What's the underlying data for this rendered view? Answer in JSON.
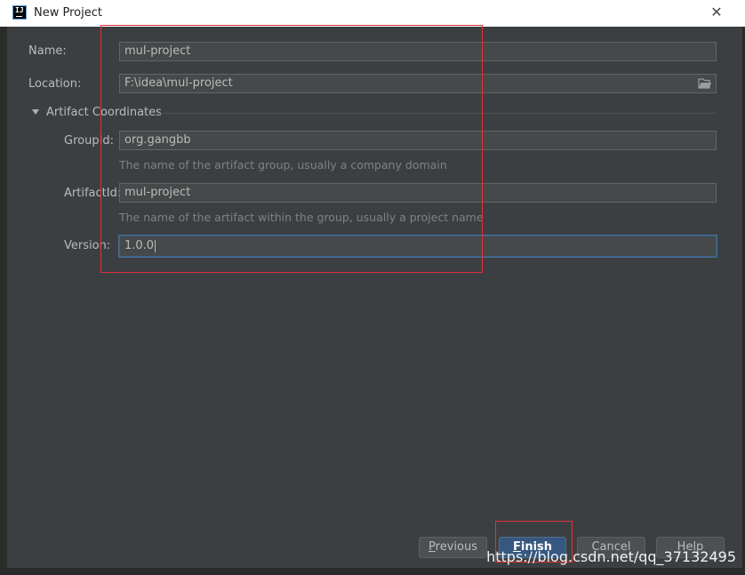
{
  "window": {
    "title": "New Project",
    "icon": "intellij-idea-icon",
    "close_glyph": "✕"
  },
  "form": {
    "name": {
      "label": "Name:",
      "value": "mul-project"
    },
    "location": {
      "label": "Location:",
      "value": "F:\\idea\\mul-project",
      "browse_icon": "folder-icon"
    },
    "section": {
      "label": "Artifact Coordinates",
      "expanded": true
    },
    "group_id": {
      "label": "GroupId:",
      "value": "org.gangbb",
      "hint": "The name of the artifact group, usually a company domain"
    },
    "artifact_id": {
      "label": "ArtifactId:",
      "value": "mul-project",
      "hint": "The name of the artifact within the group, usually a project name"
    },
    "version": {
      "label": "Version:",
      "value": "1.0.0",
      "focused": true
    }
  },
  "buttons": {
    "previous": {
      "mnemonic": "P",
      "rest": "revious"
    },
    "finish": {
      "mnemonic": "F",
      "rest": "inish"
    },
    "cancel": {
      "label": "Cancel"
    },
    "help": {
      "label": "Help"
    }
  },
  "watermark": "https://blog.csdn.net/qq_37132495",
  "colors": {
    "background": "#3c3f41",
    "field_bg": "#45494a",
    "focus_border": "#466d94",
    "primary_button": "#365880",
    "annotation_red": "#e0303a",
    "hint_text": "#808080"
  }
}
